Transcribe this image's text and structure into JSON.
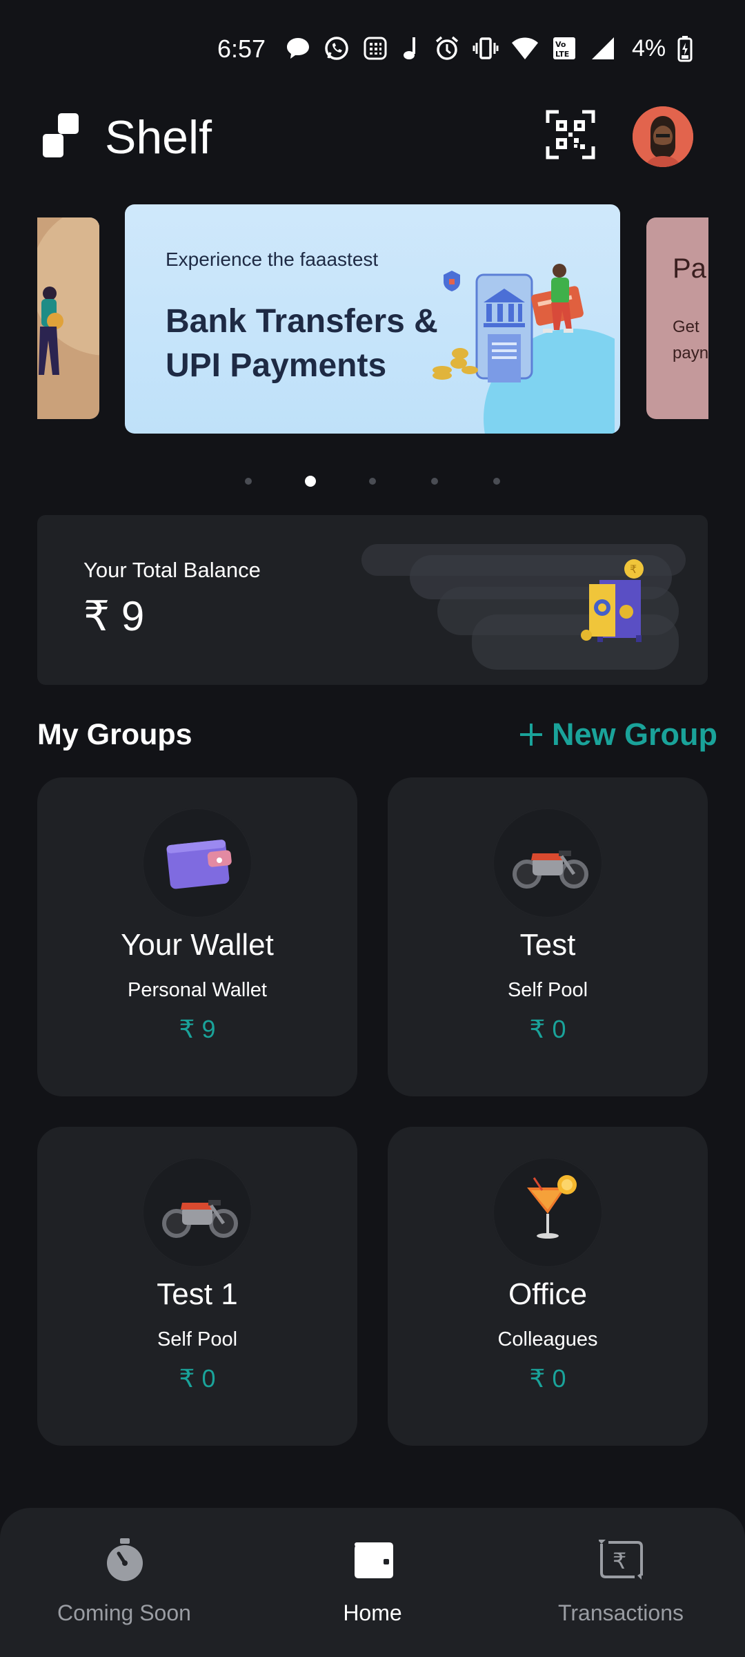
{
  "status_bar": {
    "time": "6:57",
    "battery": "4%"
  },
  "header": {
    "app_title": "Shelf",
    "qr_icon": "qr-code-scan-icon",
    "avatar_icon": "user-avatar"
  },
  "carousel": {
    "active_index": 1,
    "slide_count": 5,
    "main_banner": {
      "kicker": "Experience the faaastest",
      "title": "Bank Transfers & UPI Payments"
    },
    "right_peek": {
      "title": "Pa",
      "subtitle_line1": "Get",
      "subtitle_line2": "payn"
    }
  },
  "balance": {
    "label": "Your Total Balance",
    "value": "₹ 9"
  },
  "groups": {
    "title": "My Groups",
    "new_group_label": "New Group",
    "items": [
      {
        "name": "Your Wallet",
        "type": "Personal Wallet",
        "amount": "₹ 9",
        "icon": "wallet-icon"
      },
      {
        "name": "Test",
        "type": "Self Pool",
        "amount": "₹ 0",
        "icon": "motorcycle-icon"
      },
      {
        "name": "Test 1",
        "type": "Self Pool",
        "amount": "₹ 0",
        "icon": "motorcycle-icon"
      },
      {
        "name": "Office",
        "type": "Colleagues",
        "amount": "₹ 0",
        "icon": "cocktail-icon"
      }
    ]
  },
  "bottom_nav": {
    "items": [
      {
        "label": "Coming Soon",
        "icon": "stopwatch-icon",
        "active": false
      },
      {
        "label": "Home",
        "icon": "wallet-icon",
        "active": true
      },
      {
        "label": "Transactions",
        "icon": "rupee-exchange-icon",
        "active": false
      }
    ]
  },
  "colors": {
    "background": "#121317",
    "card": "#1f2125",
    "accent": "#1aa39a"
  }
}
